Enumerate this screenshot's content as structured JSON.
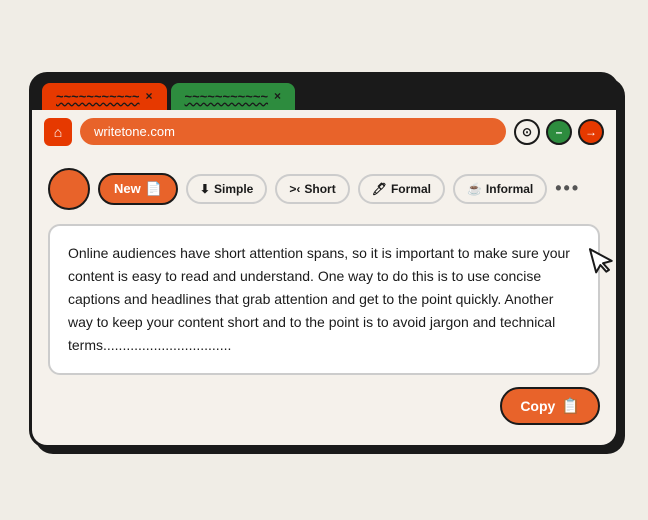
{
  "tabs": [
    {
      "id": "tab1",
      "label": "~~~~~~~~~~~",
      "close": "×"
    },
    {
      "id": "tab2",
      "label": "~~~~~~~~~~~",
      "close": "×"
    }
  ],
  "addressBar": {
    "url": "writetone.com",
    "homeIcon": "⌂",
    "controls": [
      "⊙",
      "–",
      "→"
    ]
  },
  "toolbar": {
    "newLabel": "New",
    "newIcon": "📄",
    "buttons": [
      {
        "id": "simple",
        "icon": "⬇",
        "label": "Simple"
      },
      {
        "id": "short",
        "icon": ">‹",
        "label": "Short"
      },
      {
        "id": "formal",
        "icon": "🖊",
        "label": "Formal"
      },
      {
        "id": "informal",
        "icon": "☕",
        "label": "Informal"
      }
    ],
    "moreLabel": "•••"
  },
  "content": {
    "text": "Online audiences have short attention spans, so it is important to make sure your content is easy to read and understand. One way to do this is to use concise captions and headlines that grab attention and get to the point quickly. Another way to keep your content short and to the point is to avoid jargon and technical terms................................."
  },
  "copyButton": {
    "label": "Copy",
    "icon": "📋"
  },
  "colors": {
    "orange": "#e8632a",
    "darkOrange": "#e63900",
    "green": "#2d8c3e",
    "dark": "#1a1a1a",
    "bg": "#f5f1eb"
  }
}
